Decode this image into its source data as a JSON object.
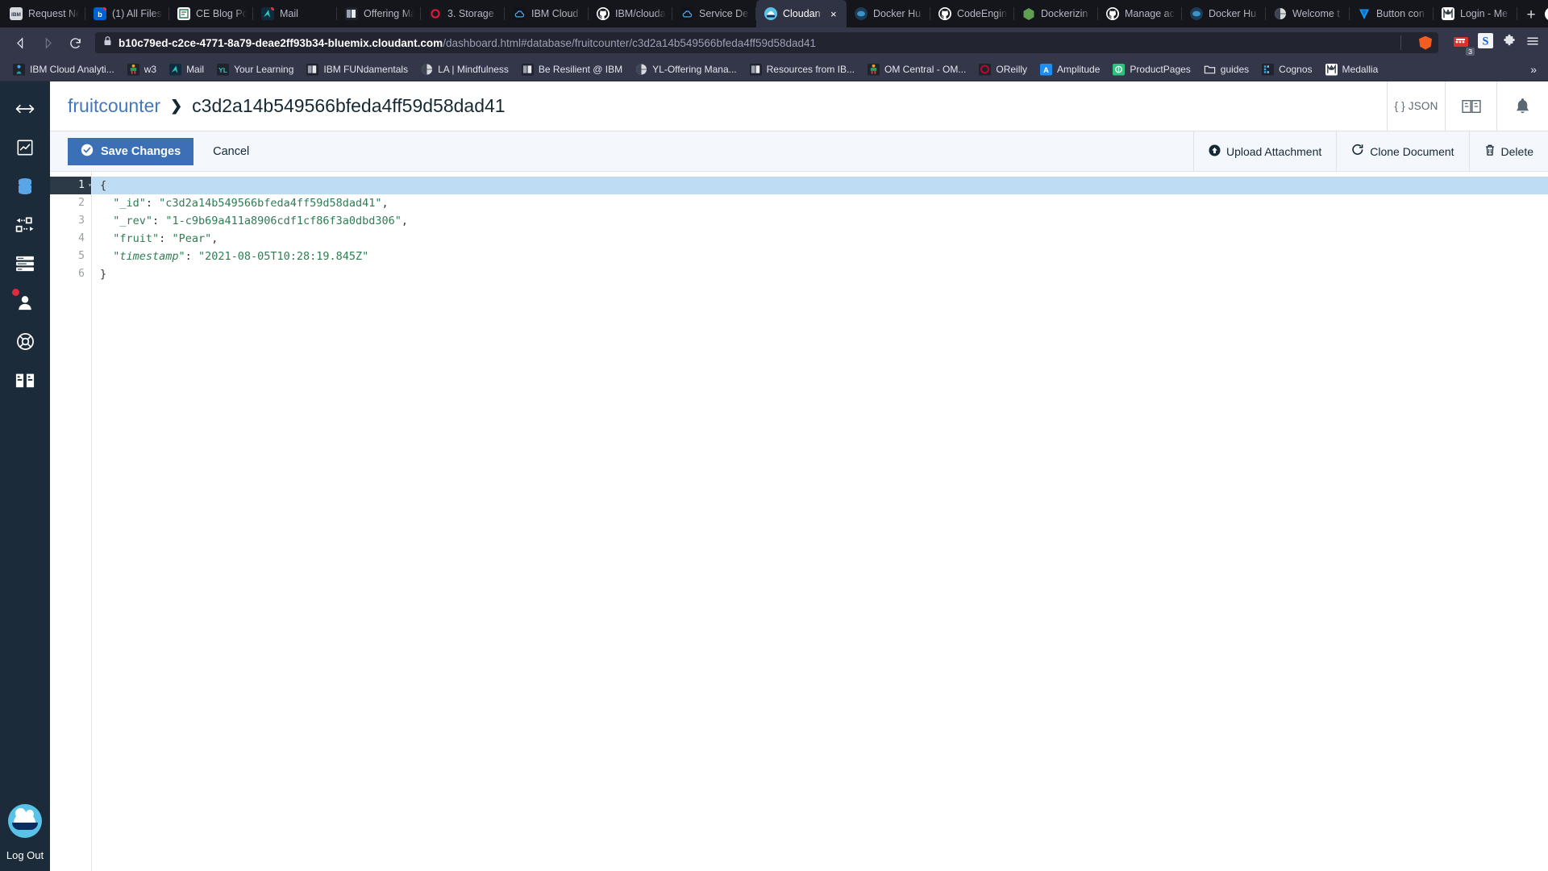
{
  "browser": {
    "tabs": [
      {
        "label": "Request Ne",
        "icon": "ibm-icon",
        "dot": false,
        "active": false
      },
      {
        "label": "(1) All Files",
        "icon": "box-icon",
        "dot": true,
        "active": false
      },
      {
        "label": "CE Blog Po",
        "icon": "note-icon",
        "dot": false,
        "active": false
      },
      {
        "label": "Mail",
        "icon": "mail-icon",
        "dot": true,
        "active": false
      },
      {
        "label": "Offering Ma",
        "icon": "grid-icon",
        "dot": false,
        "active": false
      },
      {
        "label": "3. Storage",
        "icon": "o-icon",
        "dot": false,
        "active": false
      },
      {
        "label": "IBM Cloud",
        "icon": "ibmcloud-icon",
        "dot": false,
        "active": false
      },
      {
        "label": "IBM/clouda",
        "icon": "github-icon",
        "dot": false,
        "active": false
      },
      {
        "label": "Service De",
        "icon": "ibmcloud-icon",
        "dot": false,
        "active": false
      },
      {
        "label": "Cloudan",
        "icon": "cloudant-icon",
        "dot": false,
        "active": true
      },
      {
        "label": "Docker Hu",
        "icon": "docker-icon",
        "dot": false,
        "active": false
      },
      {
        "label": "CodeEngin",
        "icon": "github-icon",
        "dot": false,
        "active": false
      },
      {
        "label": "Dockerizin",
        "icon": "node-icon",
        "dot": false,
        "active": false
      },
      {
        "label": "Manage ac",
        "icon": "github-icon",
        "dot": false,
        "active": false
      },
      {
        "label": "Docker Hu",
        "icon": "docker-icon",
        "dot": false,
        "active": false
      },
      {
        "label": "Welcome t",
        "icon": "globe-icon",
        "dot": false,
        "active": false
      },
      {
        "label": "Button con",
        "icon": "vuetify-icon",
        "dot": false,
        "active": false
      },
      {
        "label": "Login - Me",
        "icon": "medallia-icon",
        "dot": false,
        "active": false
      }
    ],
    "new_tab_label": "+",
    "close_label": "×",
    "url": {
      "host": "b10c79ed-c2ce-4771-8a79-deae2ff93b34-bluemix.cloudant.com",
      "path": "/dashboard.html#database/fruitcounter/c3d2a14b549566bfeda4ff59d58dad41"
    },
    "extension_badge": "3",
    "bookmarks": [
      {
        "label": "IBM Cloud Analyti...",
        "icon": "person-blue-icon"
      },
      {
        "label": "w3",
        "icon": "w3-icon"
      },
      {
        "label": "Mail",
        "icon": "mail-icon"
      },
      {
        "label": "Your Learning",
        "icon": "yl-icon"
      },
      {
        "label": "IBM FUNdamentals",
        "icon": "grid-icon"
      },
      {
        "label": "LA | Mindfulness",
        "icon": "globe-icon"
      },
      {
        "label": "Be Resilient @ IBM",
        "icon": "grid-icon"
      },
      {
        "label": "YL-Offering Mana...",
        "icon": "globe-icon"
      },
      {
        "label": "Resources from IB...",
        "icon": "grid-icon"
      },
      {
        "label": "OM Central - OM...",
        "icon": "w3-icon"
      },
      {
        "label": "OReilly",
        "icon": "oreilly-icon"
      },
      {
        "label": "Amplitude",
        "icon": "amplitude-icon"
      },
      {
        "label": "ProductPages",
        "icon": "productpages-icon"
      },
      {
        "label": "guides",
        "icon": "folder-icon"
      },
      {
        "label": "Cognos",
        "icon": "cognos-icon"
      },
      {
        "label": "Medallia",
        "icon": "medallia-icon"
      }
    ],
    "bookmarks_overflow": "»"
  },
  "sidebar": {
    "items": [
      {
        "name": "expand-collapse-icon"
      },
      {
        "name": "monitoring-icon"
      },
      {
        "name": "database-icon"
      },
      {
        "name": "replication-icon"
      },
      {
        "name": "activity-tasks-icon"
      },
      {
        "name": "account-icon",
        "badge": true
      },
      {
        "name": "support-icon"
      },
      {
        "name": "docs-icon"
      }
    ],
    "logout_label": "Log Out",
    "logo_name": "cloudant-logo"
  },
  "header": {
    "database": "fruitcounter",
    "separator": "❯",
    "document_id": "c3d2a14b549566bfeda4ff59d58dad41",
    "actions": [
      {
        "label": "{ } JSON",
        "name": "json-view-button"
      },
      {
        "label": "",
        "name": "docs-book-button"
      },
      {
        "label": "",
        "name": "notifications-bell-button"
      }
    ]
  },
  "toolbar": {
    "save_label": "Save Changes",
    "cancel_label": "Cancel",
    "upload_label": "Upload Attachment",
    "clone_label": "Clone Document",
    "delete_label": "Delete"
  },
  "editor": {
    "active_line": 1,
    "lines": [
      {
        "n": "1",
        "text": "{",
        "type": "brace",
        "fold": true
      },
      {
        "n": "2",
        "key": "\"_id\"",
        "value": "\"c3d2a14b549566bfeda4ff59d58dad41\"",
        "trail": ","
      },
      {
        "n": "3",
        "key": "\"_rev\"",
        "value": "\"1-c9b69a411a8906cdf1cf86f3a0dbd306\"",
        "trail": ","
      },
      {
        "n": "4",
        "key": "\"fruit\"",
        "value": "\"Pear\"",
        "trail": ","
      },
      {
        "n": "5",
        "key": "\"timestamp\"",
        "value": "\"2021-08-05T10:28:19.845Z\"",
        "trail": ""
      },
      {
        "n": "6",
        "text": "}",
        "type": "brace",
        "fold": false
      }
    ],
    "document": {
      "_id": "c3d2a14b549566bfeda4ff59d58dad41",
      "_rev": "1-c9b69a411a8906cdf1cf86f3a0dbd306",
      "fruit": "Pear",
      "timestamp": "2021-08-05T10:28:19.845Z"
    }
  },
  "colors": {
    "accent": "#3b6fb6",
    "link": "#4178be",
    "sidebar_bg": "#1b2b39",
    "chrome_bg": "#34374a",
    "json_string": "#2e7d52",
    "active_line": "#bedcf4"
  }
}
